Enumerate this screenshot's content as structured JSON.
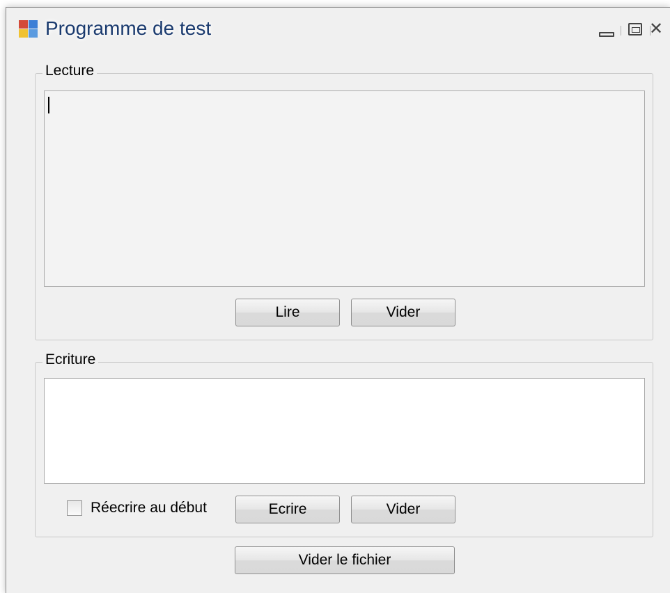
{
  "window": {
    "title": "Programme de test"
  },
  "titlebar": {
    "minimize_icon": "minimize-icon",
    "maximize_icon": "maximize-icon",
    "close_icon": "close-icon"
  },
  "lecture": {
    "legend": "Lecture",
    "text_value": "",
    "read_button": "Lire",
    "clear_button": "Vider"
  },
  "ecriture": {
    "legend": "Ecriture",
    "text_value": "",
    "rewrite_checkbox_label": "Réecrire au début",
    "rewrite_checked": false,
    "write_button": "Ecrire",
    "clear_button": "Vider"
  },
  "footer": {
    "clear_file_button": "Vider le fichier"
  }
}
